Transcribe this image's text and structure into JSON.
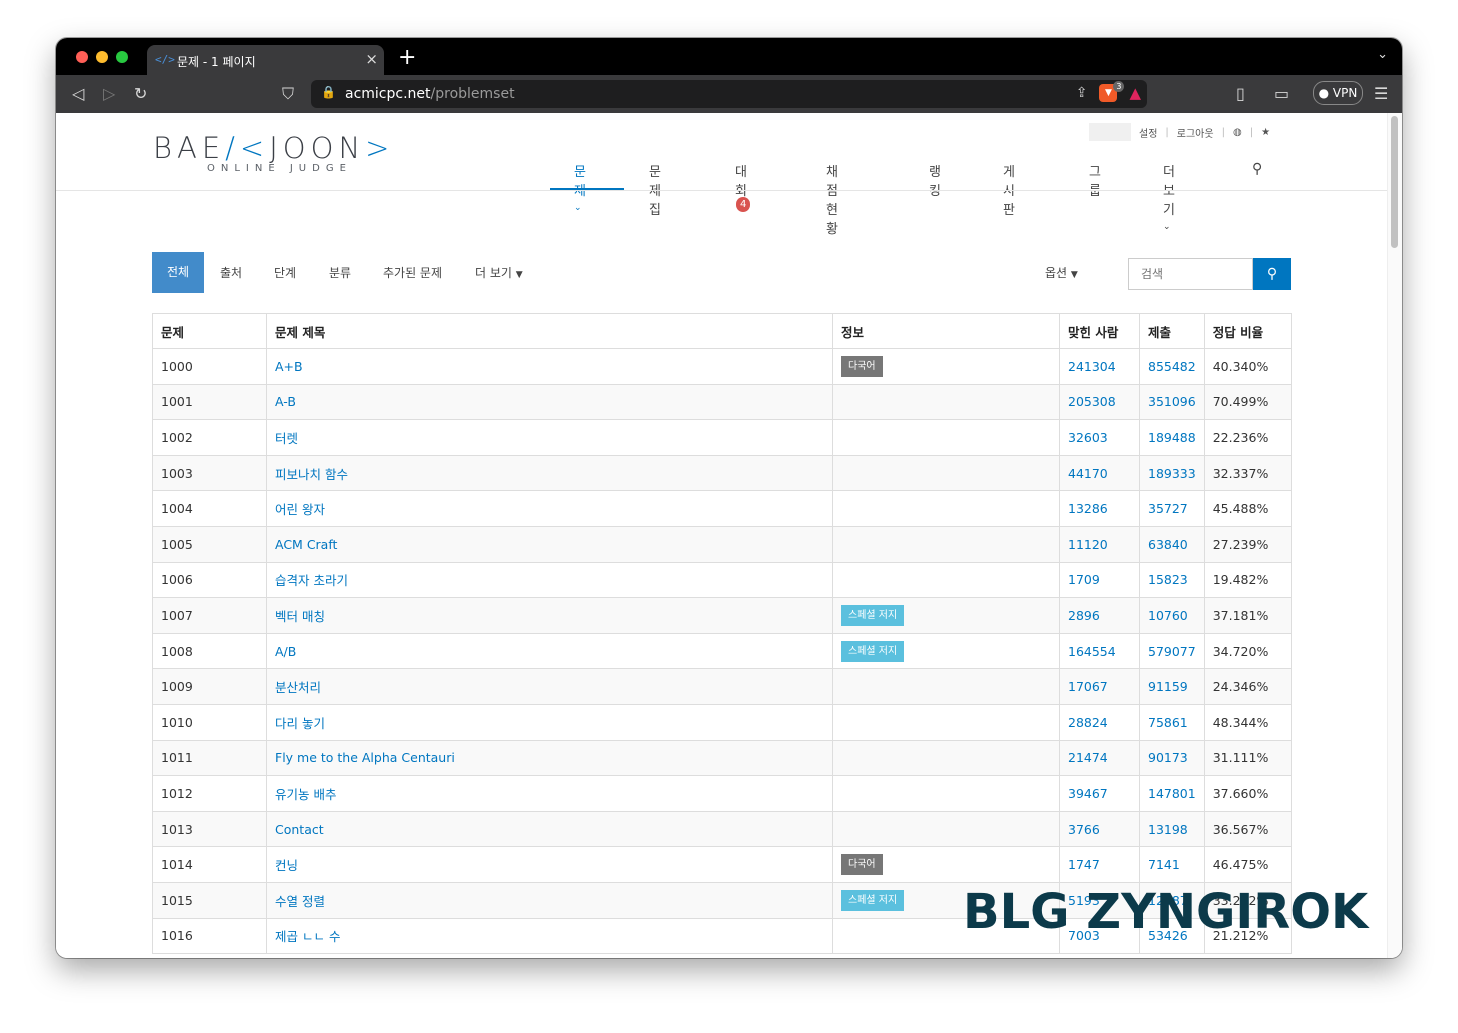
{
  "browser": {
    "tab_icon": "</>",
    "tab_title": "문제 - 1 페이지",
    "url_host": "acmicpc.net",
    "url_path": "/problemset",
    "vpn_label": "● VPN",
    "brave_badge": "3",
    "colors": {
      "tabbar": "#000000",
      "toolbar": "#3a3a3c",
      "urlbar": "#1e1e1f"
    }
  },
  "site": {
    "logo_left": "BAE",
    "logo_mid": "/<",
    "logo_right": "JOON",
    "logo_end": ">",
    "logo_sub": "ONLINE JUDGE",
    "settings": "설정",
    "logout": "로그아웃",
    "accent": "#0076c0"
  },
  "nav": {
    "problems": "문제",
    "workbook": "문제집",
    "contest": "대회",
    "contest_badge": "4",
    "status": "채점 현황",
    "ranking": "랭킹",
    "board": "게시판",
    "group": "그룹",
    "more": "더 보기"
  },
  "subnav": {
    "all": "전체",
    "source": "출처",
    "level": "단계",
    "category": "분류",
    "added": "추가된 문제",
    "more": "더 보기",
    "options": "옵션",
    "search_placeholder": "검색"
  },
  "table": {
    "headers": {
      "id": "문제",
      "title": "문제 제목",
      "info": "정보",
      "solved": "맞힌 사람",
      "submits": "제출",
      "ratio": "정답 비율"
    },
    "rows": [
      {
        "id": "1000",
        "title": "A+B",
        "info": "다국어",
        "info_type": "gray",
        "solved": "241304",
        "submits": "855482",
        "ratio": "40.340%"
      },
      {
        "id": "1001",
        "title": "A-B",
        "info": "",
        "info_type": "",
        "solved": "205308",
        "submits": "351096",
        "ratio": "70.499%"
      },
      {
        "id": "1002",
        "title": "터렛",
        "info": "",
        "info_type": "",
        "solved": "32603",
        "submits": "189488",
        "ratio": "22.236%"
      },
      {
        "id": "1003",
        "title": "피보나치 함수",
        "info": "",
        "info_type": "",
        "solved": "44170",
        "submits": "189333",
        "ratio": "32.337%"
      },
      {
        "id": "1004",
        "title": "어린 왕자",
        "info": "",
        "info_type": "",
        "solved": "13286",
        "submits": "35727",
        "ratio": "45.488%"
      },
      {
        "id": "1005",
        "title": "ACM Craft",
        "info": "",
        "info_type": "",
        "solved": "11120",
        "submits": "63840",
        "ratio": "27.239%"
      },
      {
        "id": "1006",
        "title": "습격자 초라기",
        "info": "",
        "info_type": "",
        "solved": "1709",
        "submits": "15823",
        "ratio": "19.482%"
      },
      {
        "id": "1007",
        "title": "벡터 매칭",
        "info": "스페셜 저지",
        "info_type": "sky",
        "solved": "2896",
        "submits": "10760",
        "ratio": "37.181%"
      },
      {
        "id": "1008",
        "title": "A/B",
        "info": "스페셜 저지",
        "info_type": "sky",
        "solved": "164554",
        "submits": "579077",
        "ratio": "34.720%"
      },
      {
        "id": "1009",
        "title": "분산처리",
        "info": "",
        "info_type": "",
        "solved": "17067",
        "submits": "91159",
        "ratio": "24.346%"
      },
      {
        "id": "1010",
        "title": "다리 놓기",
        "info": "",
        "info_type": "",
        "solved": "28824",
        "submits": "75861",
        "ratio": "48.344%"
      },
      {
        "id": "1011",
        "title": "Fly me to the Alpha Centauri",
        "info": "",
        "info_type": "",
        "solved": "21474",
        "submits": "90173",
        "ratio": "31.111%"
      },
      {
        "id": "1012",
        "title": "유기농 배추",
        "info": "",
        "info_type": "",
        "solved": "39467",
        "submits": "147801",
        "ratio": "37.660%"
      },
      {
        "id": "1013",
        "title": "Contact",
        "info": "",
        "info_type": "",
        "solved": "3766",
        "submits": "13198",
        "ratio": "36.567%"
      },
      {
        "id": "1014",
        "title": "컨닝",
        "info": "다국어",
        "info_type": "gray",
        "solved": "1747",
        "submits": "7141",
        "ratio": "46.475%"
      },
      {
        "id": "1015",
        "title": "수열 정렬",
        "info": "스페셜 저지",
        "info_type": "sky",
        "solved": "5193",
        "submits": "12087",
        "ratio": "33.202%"
      },
      {
        "id": "1016",
        "title": "제곱 ㄴㄴ 수",
        "info": "",
        "info_type": "",
        "solved": "7003",
        "submits": "53426",
        "ratio": "21.212%"
      }
    ]
  },
  "watermark": "BLG ZYNGIROK"
}
